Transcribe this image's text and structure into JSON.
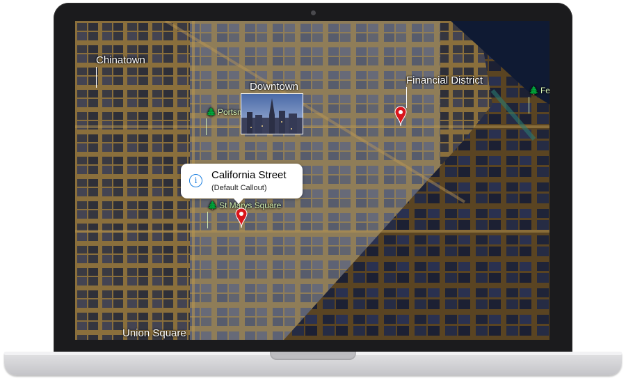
{
  "map": {
    "districts": {
      "chinatown": "Chinatown",
      "financial_district": "Financial District",
      "union_square": "Union Square",
      "downtown": "Downtown"
    },
    "parks": {
      "portsmouth": "Portsm",
      "st_marys": "St Marys Square",
      "ferry": "Fer"
    },
    "tree_glyph": "🌲",
    "callout": {
      "title": "California Street",
      "subtitle": "(Default Callout)",
      "info_glyph": "i"
    },
    "pin_color": "#d9151b",
    "accent_color": "#1b7fe0"
  }
}
